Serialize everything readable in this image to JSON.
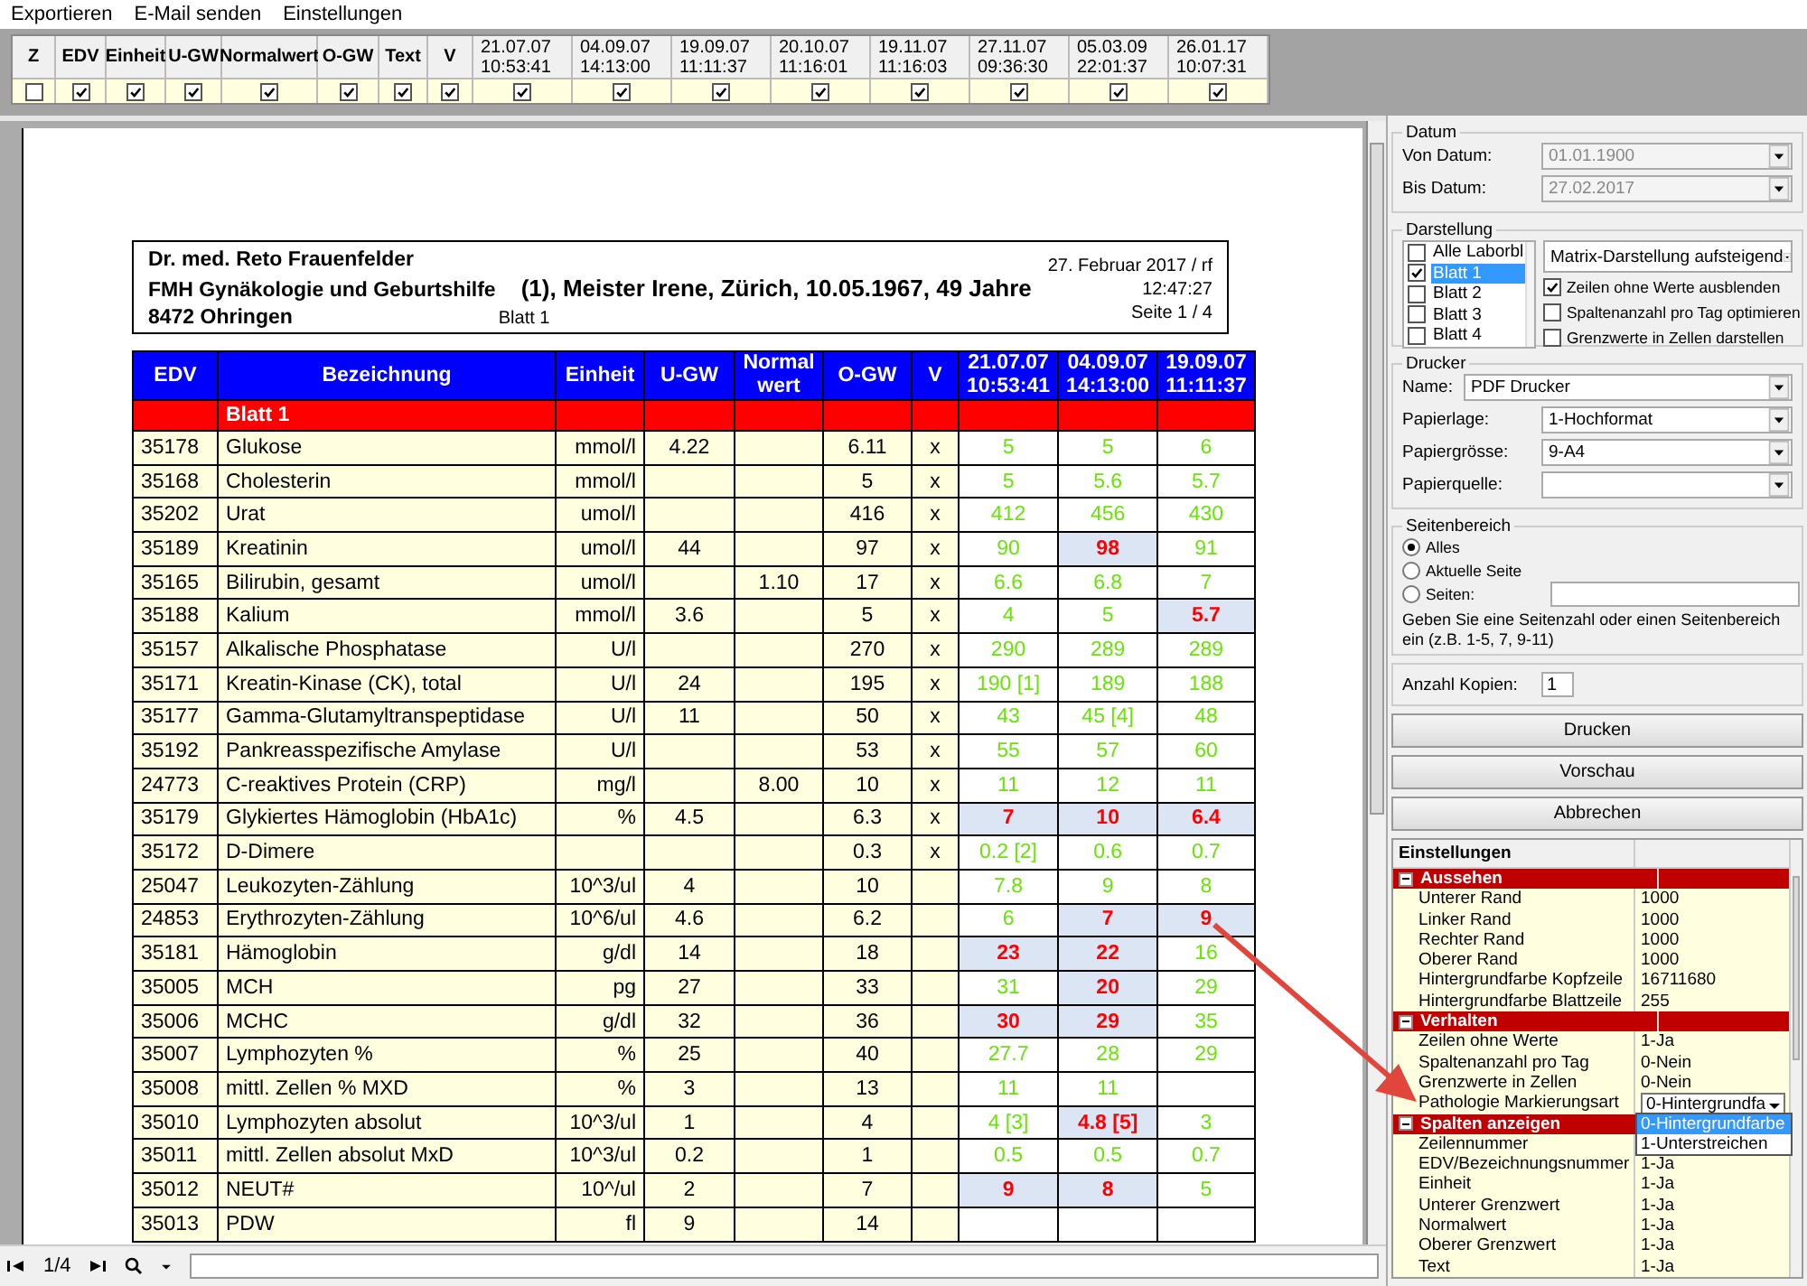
{
  "menu": [
    "Exportieren",
    "E-Mail senden",
    "Einstellungen"
  ],
  "strip": {
    "columns": [
      {
        "label": "Z",
        "checked": false
      },
      {
        "label": "EDV",
        "checked": true
      },
      {
        "label": "Einheit",
        "checked": true
      },
      {
        "label": "U-GW",
        "checked": true
      },
      {
        "label": "Normalwert",
        "checked": true
      },
      {
        "label": "O-GW",
        "checked": true
      },
      {
        "label": "Text",
        "checked": true
      },
      {
        "label": "V",
        "checked": true
      },
      {
        "date": "21.07.07",
        "time": "10:53:41",
        "checked": true
      },
      {
        "date": "04.09.07",
        "time": "14:13:00",
        "checked": true
      },
      {
        "date": "19.09.07",
        "time": "11:11:37",
        "checked": true
      },
      {
        "date": "20.10.07",
        "time": "11:16:01",
        "checked": true
      },
      {
        "date": "19.11.07",
        "time": "11:16:03",
        "checked": true
      },
      {
        "date": "27.11.07",
        "time": "09:36:30",
        "checked": true
      },
      {
        "date": "05.03.09",
        "time": "22:01:37",
        "checked": true
      },
      {
        "date": "26.01.17",
        "time": "10:07:31",
        "checked": true
      }
    ]
  },
  "preview": {
    "header": {
      "doctor": "Dr. med. Reto Frauenfelder",
      "specialty": "FMH Gynäkologie und Geburtshilfe",
      "patient": "(1), Meister Irene, Zürich, 10.05.1967, 49 Jahre",
      "city": "8472 Ohringen",
      "sheet": "Blatt 1",
      "date": "27. Februar 2017 / rf",
      "time": "12:47:27",
      "page": "Seite 1 / 4"
    },
    "columns": [
      {
        "label": "EDV"
      },
      {
        "label": "Bezeichnung"
      },
      {
        "label": "Einheit"
      },
      {
        "label": "U-GW"
      },
      {
        "label": "Normal wert"
      },
      {
        "label": "O-GW"
      },
      {
        "label": "V"
      },
      {
        "date": "21.07.07",
        "time": "10:53:41"
      },
      {
        "date": "04.09.07",
        "time": "14:13:00"
      },
      {
        "date": "19.09.07",
        "time": "11:11:37"
      }
    ],
    "section": "Blatt 1",
    "rows": [
      {
        "edv": "35178",
        "name": "Glukose",
        "unit": "mmol/l",
        "ugw": "4.22",
        "ogw": "6.11",
        "v": "x",
        "results": [
          {
            "value": "5",
            "abnormal": false
          },
          {
            "value": "5",
            "abnormal": false
          },
          {
            "value": "6",
            "abnormal": false
          }
        ]
      },
      {
        "edv": "35168",
        "name": "Cholesterin",
        "unit": "mmol/l",
        "ogw": "5",
        "v": "x",
        "results": [
          {
            "value": "5",
            "abnormal": false
          },
          {
            "value": "5.6",
            "abnormal": false
          },
          {
            "value": "5.7",
            "abnormal": false
          }
        ]
      },
      {
        "edv": "35202",
        "name": "Urat",
        "unit": "umol/l",
        "ogw": "416",
        "v": "x",
        "results": [
          {
            "value": "412",
            "abnormal": false
          },
          {
            "value": "456",
            "abnormal": false
          },
          {
            "value": "430",
            "abnormal": false
          }
        ]
      },
      {
        "edv": "35189",
        "name": "Kreatinin",
        "unit": "umol/l",
        "ugw": "44",
        "ogw": "97",
        "v": "x",
        "results": [
          {
            "value": "90",
            "abnormal": false
          },
          {
            "value": "98",
            "abnormal": true
          },
          {
            "value": "91",
            "abnormal": false
          }
        ]
      },
      {
        "edv": "35165",
        "name": "Bilirubin, gesamt",
        "unit": "umol/l",
        "normal": "1.10",
        "ogw": "17",
        "v": "x",
        "results": [
          {
            "value": "6.6",
            "abnormal": false
          },
          {
            "value": "6.8",
            "abnormal": false
          },
          {
            "value": "7",
            "abnormal": false
          }
        ]
      },
      {
        "edv": "35188",
        "name": "Kalium",
        "unit": "mmol/l",
        "ugw": "3.6",
        "ogw": "5",
        "v": "x",
        "results": [
          {
            "value": "4",
            "abnormal": false
          },
          {
            "value": "5",
            "abnormal": false
          },
          {
            "value": "5.7",
            "abnormal": true
          }
        ]
      },
      {
        "edv": "35157",
        "name": "Alkalische Phosphatase",
        "unit": "U/l",
        "ogw": "270",
        "v": "x",
        "results": [
          {
            "value": "290",
            "abnormal": false
          },
          {
            "value": "289",
            "abnormal": false
          },
          {
            "value": "289",
            "abnormal": false
          }
        ]
      },
      {
        "edv": "35171",
        "name": "Kreatin-Kinase (CK), total",
        "unit": "U/l",
        "ugw": "24",
        "ogw": "195",
        "v": "x",
        "results": [
          {
            "value": "190 [1]",
            "abnormal": false
          },
          {
            "value": "189",
            "abnormal": false
          },
          {
            "value": "188",
            "abnormal": false
          }
        ]
      },
      {
        "edv": "35177",
        "name": "Gamma-Glutamyltranspeptidase",
        "unit": "U/l",
        "ugw": "11",
        "ogw": "50",
        "v": "x",
        "results": [
          {
            "value": "43",
            "abnormal": false
          },
          {
            "value": "45 [4]",
            "abnormal": false
          },
          {
            "value": "48",
            "abnormal": false
          }
        ]
      },
      {
        "edv": "35192",
        "name": "Pankreasspezifische Amylase",
        "unit": "U/l",
        "ogw": "53",
        "v": "x",
        "results": [
          {
            "value": "55",
            "abnormal": false
          },
          {
            "value": "57",
            "abnormal": false
          },
          {
            "value": "60",
            "abnormal": false
          }
        ]
      },
      {
        "edv": "24773",
        "name": "C-reaktives Protein (CRP)",
        "unit": "mg/l",
        "normal": "8.00",
        "ogw": "10",
        "v": "x",
        "results": [
          {
            "value": "11",
            "abnormal": false
          },
          {
            "value": "12",
            "abnormal": false
          },
          {
            "value": "11",
            "abnormal": false
          }
        ]
      },
      {
        "edv": "35179",
        "name": "Glykiertes Hämoglobin (HbA1c)",
        "unit": "%",
        "ugw": "4.5",
        "ogw": "6.3",
        "v": "x",
        "results": [
          {
            "value": "7",
            "abnormal": true
          },
          {
            "value": "10",
            "abnormal": true
          },
          {
            "value": "6.4",
            "abnormal": true
          }
        ]
      },
      {
        "edv": "35172",
        "name": "D-Dimere",
        "ogw": "0.3",
        "v": "x",
        "results": [
          {
            "value": "0.2 [2]",
            "abnormal": false
          },
          {
            "value": "0.6",
            "abnormal": false
          },
          {
            "value": "0.7",
            "abnormal": false
          }
        ]
      },
      {
        "edv": "25047",
        "name": "Leukozyten-Zählung",
        "unit": "10^3/ul",
        "ugw": "4",
        "ogw": "10",
        "results": [
          {
            "value": "7.8",
            "abnormal": false
          },
          {
            "value": "9",
            "abnormal": false
          },
          {
            "value": "8",
            "abnormal": false
          }
        ]
      },
      {
        "edv": "24853",
        "name": "Erythrozyten-Zählung",
        "unit": "10^6/ul",
        "ugw": "4.6",
        "ogw": "6.2",
        "results": [
          {
            "value": "6",
            "abnormal": false
          },
          {
            "value": "7",
            "abnormal": true
          },
          {
            "value": "9",
            "abnormal": true
          }
        ]
      },
      {
        "edv": "35181",
        "name": "Hämoglobin",
        "unit": "g/dl",
        "ugw": "14",
        "ogw": "18",
        "results": [
          {
            "value": "23",
            "abnormal": true
          },
          {
            "value": "22",
            "abnormal": true
          },
          {
            "value": "16",
            "abnormal": false
          }
        ]
      },
      {
        "edv": "35005",
        "name": "MCH",
        "unit": "pg",
        "ugw": "27",
        "ogw": "33",
        "results": [
          {
            "value": "31",
            "abnormal": false
          },
          {
            "value": "20",
            "abnormal": true
          },
          {
            "value": "29",
            "abnormal": false
          }
        ]
      },
      {
        "edv": "35006",
        "name": "MCHC",
        "unit": "g/dl",
        "ugw": "32",
        "ogw": "36",
        "results": [
          {
            "value": "30",
            "abnormal": true
          },
          {
            "value": "29",
            "abnormal": true
          },
          {
            "value": "35",
            "abnormal": false
          }
        ]
      },
      {
        "edv": "35007",
        "name": "Lymphozyten %",
        "unit": "%",
        "ugw": "25",
        "ogw": "40",
        "results": [
          {
            "value": "27.7",
            "abnormal": false
          },
          {
            "value": "28",
            "abnormal": false
          },
          {
            "value": "29",
            "abnormal": false
          }
        ]
      },
      {
        "edv": "35008",
        "name": "mittl. Zellen % MXD",
        "unit": "%",
        "ugw": "3",
        "ogw": "13",
        "results": [
          {
            "value": "11",
            "abnormal": false
          },
          {
            "value": "11",
            "abnormal": false
          },
          {
            "abnormal": false
          }
        ]
      },
      {
        "edv": "35010",
        "name": "Lymphozyten absolut",
        "unit": "10^3/ul",
        "ugw": "1",
        "ogw": "4",
        "results": [
          {
            "value": "4 [3]",
            "abnormal": false
          },
          {
            "value": "4.8 [5]",
            "abnormal": true
          },
          {
            "value": "3",
            "abnormal": false
          }
        ]
      },
      {
        "edv": "35011",
        "name": "mittl. Zellen absolut MxD",
        "unit": "10^3/ul",
        "ugw": "0.2",
        "ogw": "1",
        "results": [
          {
            "value": "0.5",
            "abnormal": false
          },
          {
            "value": "0.5",
            "abnormal": false
          },
          {
            "value": "0.7",
            "abnormal": false
          }
        ]
      },
      {
        "edv": "35012",
        "name": "NEUT#",
        "unit": "10^/ul",
        "ugw": "2",
        "ogw": "7",
        "results": [
          {
            "value": "9",
            "abnormal": true
          },
          {
            "value": "8",
            "abnormal": true
          },
          {
            "value": "5",
            "abnormal": false
          }
        ]
      },
      {
        "edv": "35013",
        "name": "PDW",
        "unit": "fl",
        "ugw": "9",
        "ogw": "14",
        "results": [
          {
            "abnormal": false
          },
          {
            "abnormal": false
          },
          {
            "abnormal": false
          }
        ]
      }
    ]
  },
  "nav": {
    "page": "1/4"
  },
  "datum": {
    "title": "Datum",
    "fields": [
      {
        "label": "Von Datum:",
        "value": "01.01.1900",
        "disabled": true
      },
      {
        "label": "Bis Datum:",
        "value": "27.02.2017",
        "disabled": true
      }
    ]
  },
  "darstellung": {
    "title": "Darstellung",
    "sheets": [
      {
        "label": "Alle Laborbl",
        "checked": false,
        "selected": false
      },
      {
        "label": "Blatt 1",
        "checked": true,
        "selected": true
      },
      {
        "label": "Blatt 2",
        "checked": false,
        "selected": false
      },
      {
        "label": "Blatt 3",
        "checked": false,
        "selected": false
      },
      {
        "label": "Blatt 4",
        "checked": false,
        "selected": false
      }
    ],
    "mode": "Matrix-Darstellung aufsteigend",
    "options": [
      {
        "label": "Zeilen ohne Werte ausblenden",
        "checked": true
      },
      {
        "label": "Spaltenanzahl pro Tag optimieren",
        "checked": false
      },
      {
        "label": "Grenzwerte in Zellen darstellen",
        "checked": false
      }
    ]
  },
  "drucker": {
    "title": "Drucker",
    "fields": [
      {
        "label": "Name:",
        "value": "PDF Drucker"
      },
      {
        "label": "Papierlage:",
        "value": "1-Hochformat"
      },
      {
        "label": "Papiergrösse:",
        "value": "9-A4"
      },
      {
        "label": "Papierquelle:"
      }
    ]
  },
  "seitenbereich": {
    "title": "Seitenbereich",
    "options": [
      {
        "label": "Alles",
        "selected": true
      },
      {
        "label": "Aktuelle Seite",
        "selected": false
      },
      {
        "label": "Seiten:",
        "selected": false
      }
    ],
    "hint": "Geben Sie eine Seitenzahl oder einen Seitenbereich ein (z.B. 1-5, 7, 9-11)"
  },
  "copies": {
    "label": "Anzahl Kopien:",
    "value": "1"
  },
  "buttons": [
    "Drucken",
    "Vorschau",
    "Abbrechen"
  ],
  "settings": {
    "title": "Einstellungen",
    "groups": [
      {
        "name": "Aussehen",
        "expanded": true,
        "items": [
          {
            "kind": "text",
            "name": "Unterer Rand",
            "value": "1000"
          },
          {
            "kind": "text",
            "name": "Linker Rand",
            "value": "1000"
          },
          {
            "kind": "text",
            "name": "Rechter Rand",
            "value": "1000"
          },
          {
            "kind": "text",
            "name": "Oberer Rand",
            "value": "1000"
          },
          {
            "kind": "text",
            "name": "Hintergrundfarbe Kopfzeile",
            "value": "16711680"
          },
          {
            "kind": "text",
            "name": "Hintergrundfarbe Blattzeile",
            "value": "255"
          }
        ]
      },
      {
        "name": "Verhalten",
        "expanded": true,
        "items": [
          {
            "kind": "text",
            "name": "Zeilen ohne Werte",
            "value": "1-Ja"
          },
          {
            "kind": "text",
            "name": "Spaltenanzahl pro Tag",
            "value": "0-Nein"
          },
          {
            "kind": "text",
            "name": "Grenzwerte in Zellen",
            "value": "0-Nein"
          },
          {
            "kind": "dropdown",
            "name": "Pathologie Markierungsart",
            "value": "0-Hintergrundfa",
            "options": [
              {
                "label": "0-Hintergrundfarbe",
                "selected": true
              },
              {
                "label": "1-Unterstreichen",
                "selected": false
              }
            ]
          }
        ]
      },
      {
        "name": "Spalten anzeigen",
        "expanded": true,
        "items": [
          {
            "kind": "text",
            "name": "Zeilennummer"
          },
          {
            "kind": "text",
            "name": "EDV/Bezeichnungsnummer",
            "value": "1-Ja"
          },
          {
            "kind": "text",
            "name": "Einheit",
            "value": "1-Ja"
          },
          {
            "kind": "text",
            "name": "Unterer Grenzwert",
            "value": "1-Ja"
          },
          {
            "kind": "text",
            "name": "Normalwert",
            "value": "1-Ja"
          },
          {
            "kind": "text",
            "name": "Oberer Grenzwert",
            "value": "1-Ja"
          },
          {
            "kind": "text",
            "name": "Text",
            "value": "1-Ja"
          }
        ]
      }
    ]
  }
}
